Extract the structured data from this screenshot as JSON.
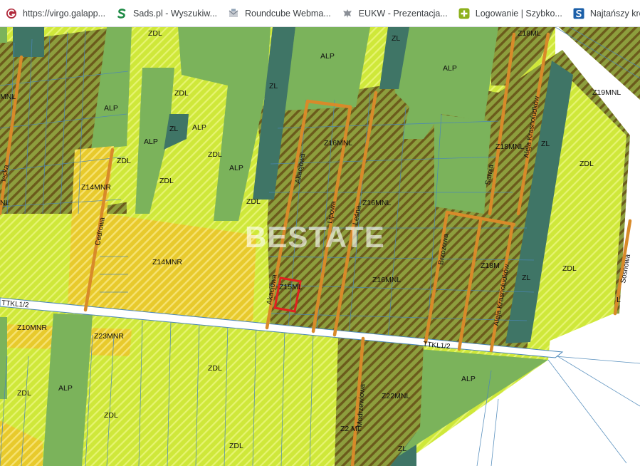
{
  "bookmarks": [
    {
      "title": "https://virgo.galapp...",
      "icon": "galapp-logo-icon"
    },
    {
      "title": "Sads.pl - Wyszukiw...",
      "icon": "sads-logo-icon"
    },
    {
      "title": "Roundcube Webma...",
      "icon": "roundcube-logo-icon"
    },
    {
      "title": "EUKW - Prezentacja...",
      "icon": "eagle-emblem-icon"
    },
    {
      "title": "Logowanie | Szybko...",
      "icon": "plus-logo-icon"
    },
    {
      "title": "Najtańszy kredyt z...",
      "icon": "s-logo-icon"
    }
  ],
  "map": {
    "watermark": "BESTATE",
    "zone_labels": {
      "zdl": "ZDL",
      "alp": "ALP",
      "zl": "ZL",
      "z14mnr": "Z14MNR",
      "z16mnl": "Z16MNL",
      "z18mnl": "Z18MNL",
      "z18ml": "Z18ML",
      "z18m": "Z18M",
      "z19mnl": "Z19MNL",
      "z15ml": "Z15ML",
      "z10mnr": "Z10MNR",
      "z23mnr": "Z23MNR",
      "z22mnl": "Z22MNL",
      "z2ml": "Z2 ML",
      "mnl": "MNL",
      "nl": "NL",
      "l": "L"
    },
    "road_labels": {
      "akacjowa": "Akacjowa",
      "lipowa": "Lipowa",
      "lesna": "Leśna",
      "sarnia": "Sarnia",
      "aleja_krasnoludkow": "Aleja Krasnoludków",
      "brzozowa": "Brzozowa",
      "cedrowa": "Cedrowa",
      "sosnowa": "Sosnowa",
      "modrzewiowa": "Modrzewiowa",
      "lecka": "lecka",
      "ttkl": "TTKL1/2"
    },
    "colors": {
      "zdl": "#cfe83a",
      "alp": "#7bb35b",
      "zl": "#3f7566",
      "hatch": "#8d9e3d",
      "hatch_stripe": "#6b5b1c",
      "mnr": "#e8ca2c",
      "road": "#d88a2a",
      "selection": "#e02020"
    }
  }
}
